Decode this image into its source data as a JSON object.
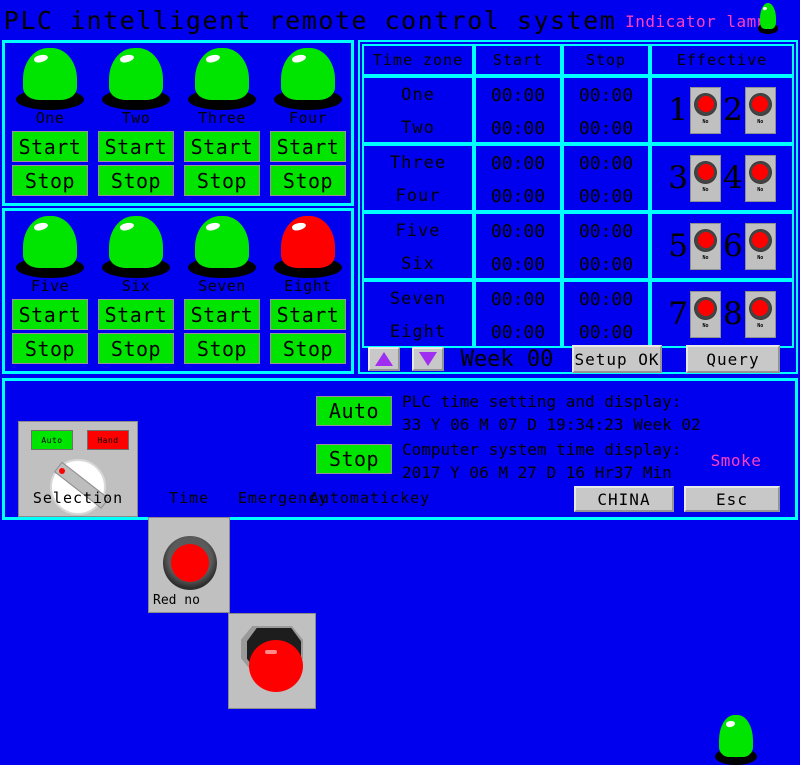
{
  "header": {
    "title": "PLC intelligent remote control system",
    "indicator_label": "Indicator lamp",
    "indicator_lamp_color": "#00e500"
  },
  "lamps": [
    {
      "label": "One",
      "color": "#00e500",
      "start": "Start",
      "stop": "Stop"
    },
    {
      "label": "Two",
      "color": "#00e500",
      "start": "Start",
      "stop": "Stop"
    },
    {
      "label": "Three",
      "color": "#00e500",
      "start": "Start",
      "stop": "Stop"
    },
    {
      "label": "Four",
      "color": "#00e500",
      "start": "Start",
      "stop": "Stop"
    },
    {
      "label": "Five",
      "color": "#00e500",
      "start": "Start",
      "stop": "Stop"
    },
    {
      "label": "Six",
      "color": "#00e500",
      "start": "Start",
      "stop": "Stop"
    },
    {
      "label": "Seven",
      "color": "#00e500",
      "start": "Start",
      "stop": "Stop"
    },
    {
      "label": "Eight",
      "color": "#ff0000",
      "start": "Start",
      "stop": "Stop"
    }
  ],
  "schedule_table": {
    "headers": [
      "Time zone",
      "Start",
      "Stop",
      "Effective"
    ],
    "rows": [
      {
        "zone_a": "One",
        "zone_b": "Two",
        "start_a": "00:00",
        "stop_a": "00:00",
        "start_b": "00:00",
        "stop_b": "00:00",
        "eff_a": "1",
        "eff_b": "2",
        "eff_a_tag": "No",
        "eff_b_tag": "No"
      },
      {
        "zone_a": "Three",
        "zone_b": "Four",
        "start_a": "00:00",
        "stop_a": "00:00",
        "start_b": "00:00",
        "stop_b": "00:00",
        "eff_a": "3",
        "eff_b": "4",
        "eff_a_tag": "No",
        "eff_b_tag": "No"
      },
      {
        "zone_a": "Five",
        "zone_b": "Six",
        "start_a": "00:00",
        "stop_a": "00:00",
        "start_b": "00:00",
        "stop_b": "00:00",
        "eff_a": "5",
        "eff_b": "6",
        "eff_a_tag": "No",
        "eff_b_tag": "No"
      },
      {
        "zone_a": "Seven",
        "zone_b": "Eight",
        "start_a": "00:00",
        "stop_a": "00:00",
        "start_b": "00:00",
        "stop_b": "00:00",
        "eff_a": "7",
        "eff_b": "8",
        "eff_a_tag": "No",
        "eff_b_tag": "No"
      }
    ],
    "footer": {
      "up_arrow": "▲",
      "down_arrow": "▼",
      "week_text": "Week  00",
      "setup_button": "Setup OK",
      "query_button": "Query"
    }
  },
  "controls": {
    "selector": {
      "auto_tag": "Auto",
      "hand_tag": "Hand",
      "caption": "Selection"
    },
    "time_button": {
      "state_text": "Red no",
      "caption": "Time"
    },
    "emergency": {
      "caption": "Emergency"
    },
    "auto_key": {
      "auto_label": "Auto",
      "stop_label": "Stop",
      "caption": "Automatickey"
    }
  },
  "time_display": {
    "plc_title": "PLC time setting and display:",
    "plc_value": "33 Y 06 M 07 D 19:34:23 Week 02",
    "pc_title": "Computer system time display:",
    "pc_value": "2017 Y 06 M 27 D  16 Hr37 Min",
    "smoke_label": "Smoke",
    "smoke_lamp_color": "#00e500"
  },
  "footer_buttons": {
    "china": "CHINA",
    "esc": "Esc"
  },
  "colors": {
    "background": "#0000ee",
    "border": "#00ffff",
    "button_green": "#00e500",
    "alarm_red": "#ff0000",
    "magenta": "#ff3fc0",
    "panel_gray": "#c0c0c0"
  }
}
